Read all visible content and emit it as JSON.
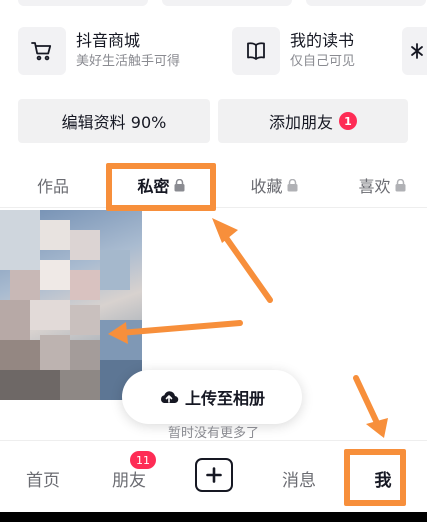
{
  "services": [
    {
      "title": "抖音商城",
      "subtitle": "美好生活触手可得",
      "icon": "cart-icon"
    },
    {
      "title": "我的读书",
      "subtitle": "仅自己可见",
      "icon": "book-icon"
    }
  ],
  "buttons": {
    "edit_profile": "编辑资料 90%",
    "add_friend": "添加朋友",
    "add_friend_badge": "1"
  },
  "tabs": {
    "works": "作品",
    "private": "私密",
    "favorites": "收藏",
    "likes": "喜欢"
  },
  "upload": {
    "label": "上传至相册"
  },
  "list_end": "暂时没有更多了",
  "nav": {
    "home": "首页",
    "friends": "朋友",
    "friends_badge": "11",
    "messages": "消息",
    "me": "我"
  },
  "colors": {
    "accent_annotation": "#f78f3b",
    "badge": "#fe2c55",
    "text_primary": "#161823",
    "text_secondary": "#8a8b91"
  }
}
